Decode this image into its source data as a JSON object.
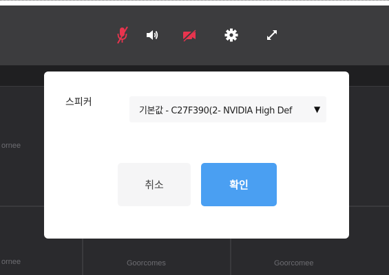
{
  "toolbar": {
    "icons": [
      "mic-muted-icon",
      "speaker-icon",
      "camera-off-icon",
      "settings-gear-icon",
      "fullscreen-icon"
    ],
    "muted_color": "#e8344e"
  },
  "background_tiles": {
    "names": [
      "ornee",
      "ornee",
      "Goorcomes",
      "Goorcomee"
    ]
  },
  "modal": {
    "speaker_label": "스피커",
    "speaker_value": "기본값 - C27F390(2- NVIDIA High Def",
    "caret": "▼",
    "cancel_label": "취소",
    "confirm_label": "확인",
    "confirm_color": "#4a9ff2"
  }
}
